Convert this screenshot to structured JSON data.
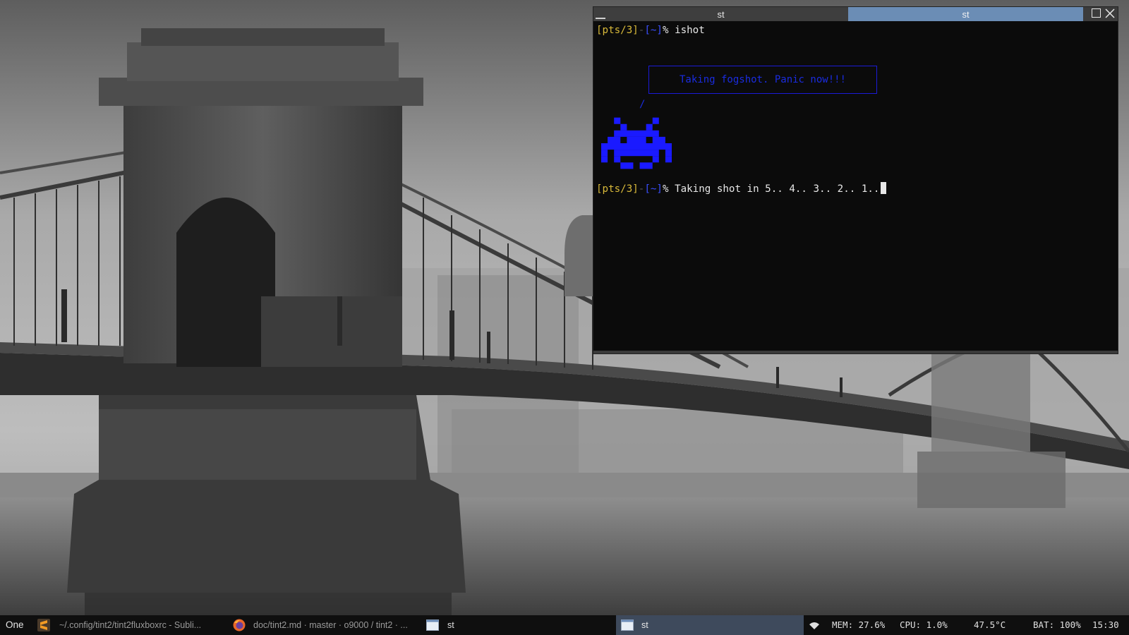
{
  "wallpaper": {
    "description_icon": "bridge-photo"
  },
  "terminal": {
    "tabs": [
      {
        "label": "st",
        "active": false
      },
      {
        "label": "st",
        "active": true
      }
    ],
    "prompt": {
      "tty": "[pts/3]",
      "sep": "-",
      "dir": "[~]",
      "symbol": "%"
    },
    "command": "ishot",
    "bubble_text": "Taking fogshot. Panic now!!!",
    "tail_char": "/",
    "countdown": "Taking shot in 5.. 4.. 3.. 2.. 1..",
    "colors": {
      "prompt": "#d8b93a",
      "dir": "#3a4fff",
      "invader": "#1a1aff",
      "active_tab": "#6b8db5"
    }
  },
  "taskbar": {
    "workspace": "One",
    "tasks": [
      {
        "icon": "sublime-text-icon",
        "label": "~/.config/tint2/tint2fluxboxrc - Subli..."
      },
      {
        "icon": "firefox-icon",
        "label": "doc/tint2.md · master · o9000 / tint2 · ..."
      },
      {
        "icon": "terminal-window-icon",
        "label": "st"
      },
      {
        "icon": "terminal-window-icon",
        "label": "st",
        "active": true
      }
    ],
    "status": {
      "wifi_icon": "wifi-icon",
      "mem": "MEM: 27.6%",
      "cpu": "CPU:  1.0%",
      "temp": "47.5°C",
      "bat": "BAT: 100%",
      "clock": "15:30"
    }
  }
}
